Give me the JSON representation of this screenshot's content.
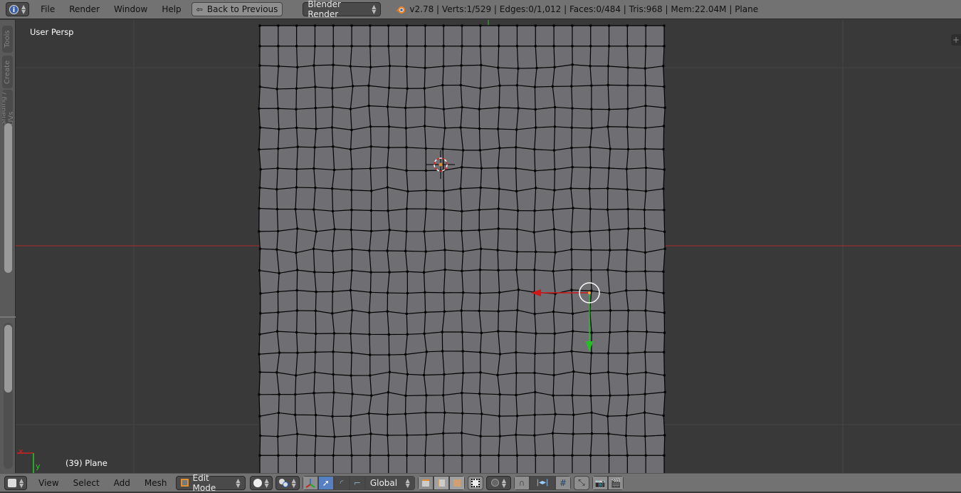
{
  "header": {
    "editor_type_icon": "info-icon",
    "menus": [
      "File",
      "Render",
      "Window",
      "Help"
    ],
    "back_button": "Back to Previous",
    "render_engine": "Blender Render",
    "logo_icon": "blender-logo-icon",
    "stats": "v2.78 | Verts:1/529 | Edges:0/1,012 | Faces:0/484 | Tris:968 | Mem:22.04M | Plane"
  },
  "toolshelf": {
    "tabs": [
      "Tools",
      "Create",
      "Shading / UVs"
    ]
  },
  "viewport": {
    "view_label": "User Persp",
    "object_label": "(39) Plane",
    "axis_x": "x",
    "axis_y": "y",
    "mesh": {
      "rows": 22,
      "cols": 22,
      "face_color": "#6f6f73",
      "edge_color": "#000000"
    },
    "colors": {
      "x_axis": "#b02a2a",
      "y_axis": "#2fbf2f",
      "background": "#393939"
    }
  },
  "footer": {
    "editor_type_icon": "3d-view-cube-icon",
    "menus": [
      "View",
      "Select",
      "Add",
      "Mesh"
    ],
    "mode": "Edit Mode",
    "shading_icon": "solid-sphere-icon",
    "pivot_icon": "pivot-point-icon",
    "orientation": "Global",
    "select_modes": [
      "vertex",
      "edge",
      "face"
    ],
    "proportional_icon": "proportional-edit-icon",
    "snap_icon": "magnet-icon",
    "snap_element_icon": "snap-increment-icon"
  }
}
